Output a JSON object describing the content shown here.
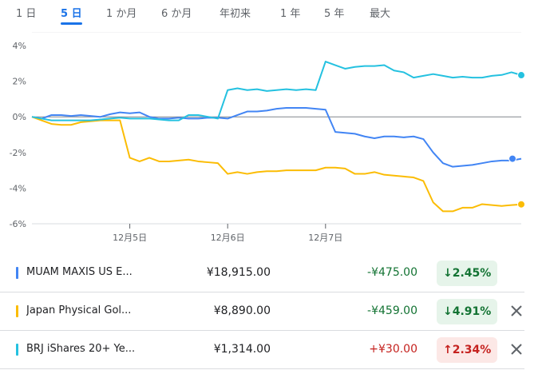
{
  "range_tabs": [
    {
      "label": "1 日",
      "active": false
    },
    {
      "label": "5 日",
      "active": true
    },
    {
      "label": "1 か月",
      "active": false
    },
    {
      "label": "6 か月",
      "active": false
    },
    {
      "label": "年初来",
      "active": false
    },
    {
      "label": "1 年",
      "active": false
    },
    {
      "label": "5 年",
      "active": false
    },
    {
      "label": "最大",
      "active": false
    }
  ],
  "chart_data": {
    "type": "line",
    "y_tick_labels": [
      "4%",
      "2%",
      "0%",
      "-2%",
      "-4%",
      "-6%"
    ],
    "y_ticks": [
      4,
      2,
      0,
      -2,
      -4,
      -6
    ],
    "ylim": [
      -6,
      4
    ],
    "x_tick_labels": [
      "12月5日",
      "12月6日",
      "12月7日"
    ],
    "x_ticks": [
      10,
      20,
      30
    ],
    "xlim": [
      0,
      50
    ],
    "grid": false,
    "baseline": 0,
    "series": [
      {
        "name": "MUAM MAXIS US E...",
        "color": "#4285f4",
        "values": [
          0,
          -0.1,
          0.1,
          0.1,
          0.05,
          0.1,
          0.05,
          0,
          0.15,
          0.25,
          0.2,
          0.25,
          0,
          -0.1,
          -0.1,
          -0.05,
          -0.1,
          -0.1,
          -0.05,
          -0.05,
          -0.1,
          0.1,
          0.3,
          0.3,
          0.35,
          0.45,
          0.5,
          0.5,
          0.5,
          0.45,
          0.4,
          -0.85,
          -0.9,
          -0.95,
          -1.1,
          -1.2,
          -1.1,
          -1.1,
          -1.15,
          -1.1,
          -1.25,
          -2.0,
          -2.6,
          -2.8,
          -2.75,
          -2.7,
          -2.6,
          -2.5,
          -2.45,
          -2.45,
          -2.35
        ]
      },
      {
        "name": "Japan Physical Gol...",
        "color": "#fbbc04",
        "values": [
          0,
          -0.2,
          -0.4,
          -0.45,
          -0.45,
          -0.3,
          -0.25,
          -0.2,
          -0.2,
          -0.2,
          -2.3,
          -2.5,
          -2.3,
          -2.5,
          -2.5,
          -2.45,
          -2.4,
          -2.5,
          -2.55,
          -2.6,
          -3.2,
          -3.1,
          -3.2,
          -3.1,
          -3.05,
          -3.05,
          -3.0,
          -3.0,
          -3.0,
          -3.0,
          -2.85,
          -2.85,
          -2.9,
          -3.2,
          -3.2,
          -3.1,
          -3.25,
          -3.3,
          -3.35,
          -3.4,
          -3.6,
          -4.8,
          -5.3,
          -5.3,
          -5.1,
          -5.1,
          -4.9,
          -4.95,
          -5.0,
          -4.95,
          -4.91
        ]
      },
      {
        "name": "BRJ iShares 20+ Ye...",
        "color": "#24c1e0",
        "values": [
          0,
          -0.1,
          -0.2,
          -0.2,
          -0.2,
          -0.2,
          -0.2,
          -0.15,
          -0.1,
          -0.05,
          -0.1,
          -0.1,
          -0.1,
          -0.15,
          -0.2,
          -0.2,
          0.1,
          0.1,
          0,
          -0.1,
          1.5,
          1.6,
          1.5,
          1.55,
          1.45,
          1.5,
          1.55,
          1.5,
          1.55,
          1.5,
          3.1,
          2.9,
          2.7,
          2.8,
          2.85,
          2.85,
          2.9,
          2.6,
          2.5,
          2.2,
          2.3,
          2.4,
          2.3,
          2.2,
          2.25,
          2.2,
          2.2,
          2.3,
          2.35,
          2.5,
          2.34
        ]
      }
    ]
  },
  "holdings": [
    {
      "name": "MUAM MAXIS US E...",
      "price": "¥18,915.00",
      "change": "-¥475.00",
      "percent_arrow": "↓",
      "percent": "2.45%",
      "direction": "down",
      "color": "#4285f4",
      "removable": false
    },
    {
      "name": "Japan Physical Gol...",
      "price": "¥8,890.00",
      "change": "-¥459.00",
      "percent_arrow": "↓",
      "percent": "4.91%",
      "direction": "down",
      "color": "#fbbc04",
      "removable": true
    },
    {
      "name": "BRJ iShares 20+ Ye...",
      "price": "¥1,314.00",
      "change": "+¥30.00",
      "percent_arrow": "↑",
      "percent": "2.34%",
      "direction": "up",
      "color": "#24c1e0",
      "removable": true
    }
  ],
  "icons": {
    "close": "close-icon"
  }
}
